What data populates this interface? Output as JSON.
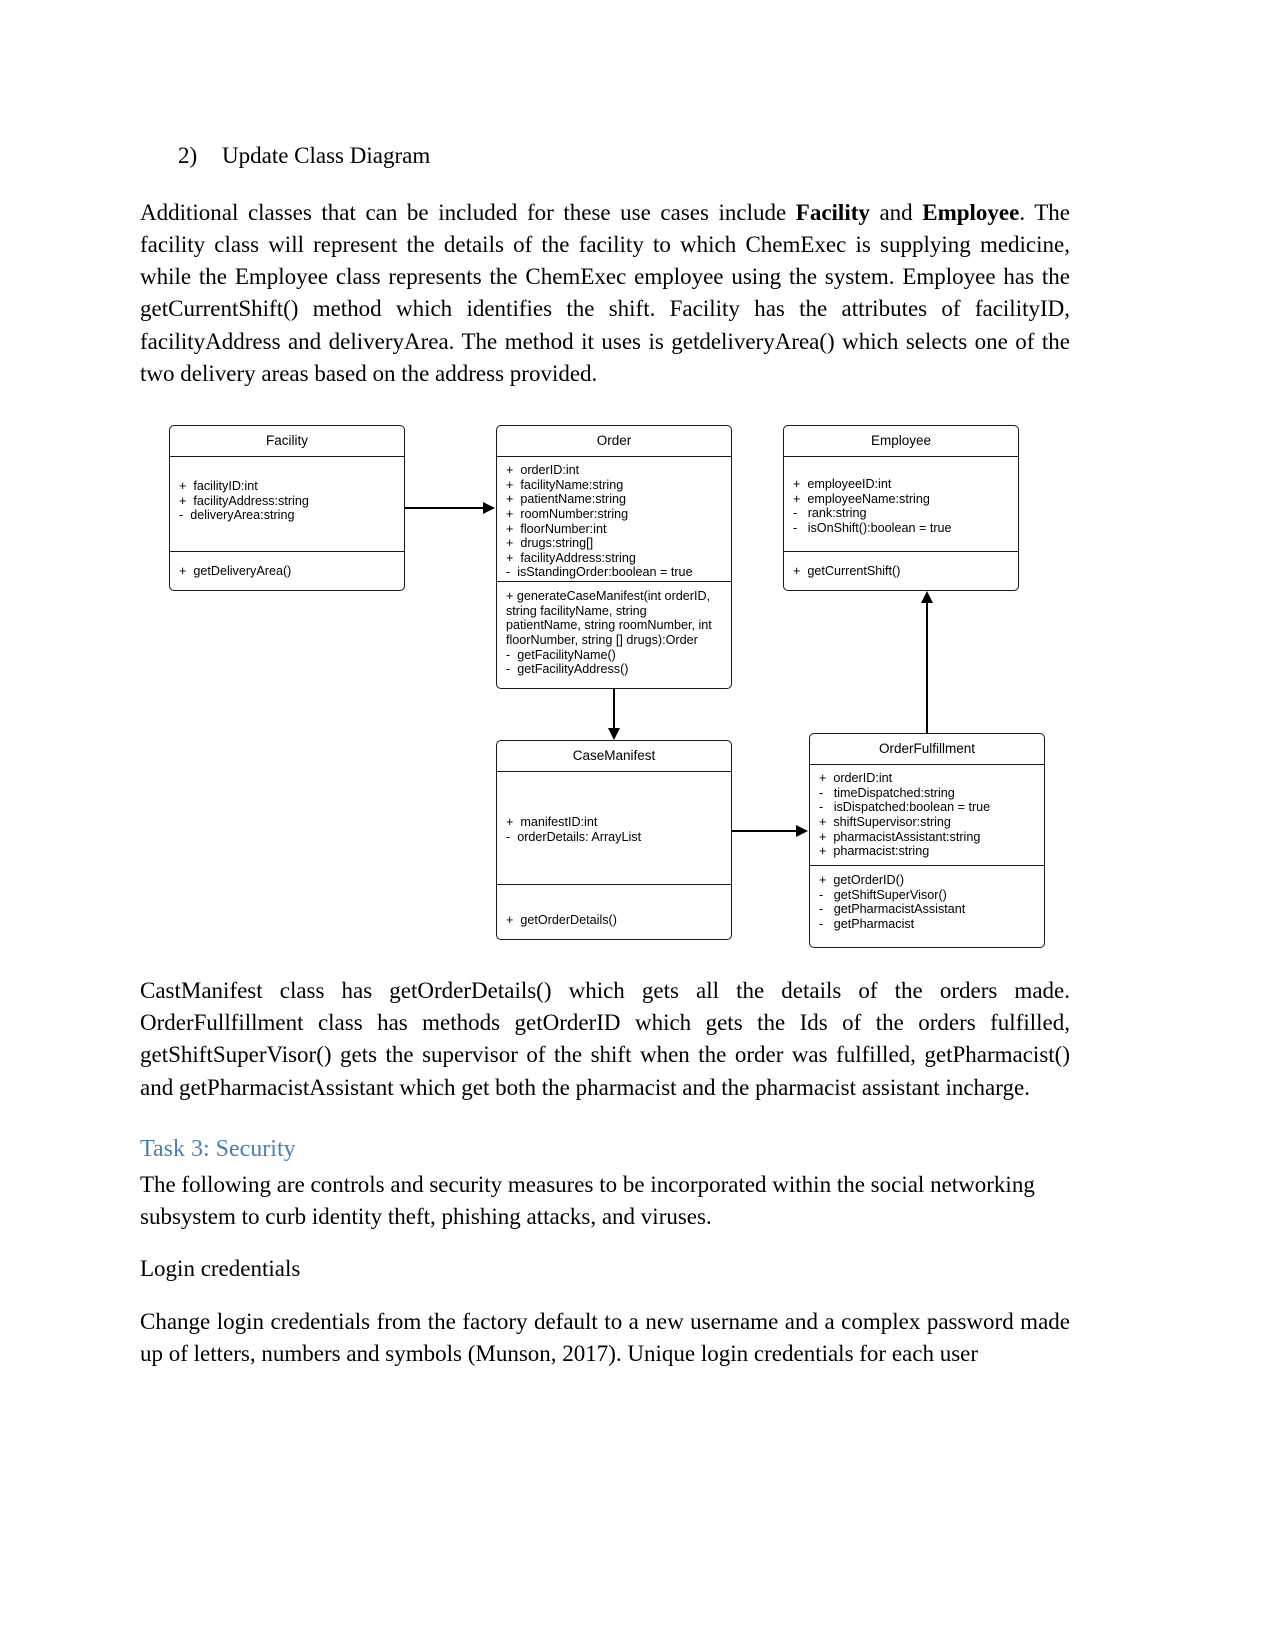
{
  "section": {
    "number": "2)",
    "title": "Update Class Diagram"
  },
  "paragraphs": {
    "intro_a": "Additional classes that can be included for these use cases include ",
    "intro_bold1": "Facility",
    "intro_b": " and ",
    "intro_bold2": "Employee",
    "intro_c": ". The facility class will represent the details of the facility to which ChemExec is supplying medicine, while the Employee class represents the ChemExec employee using the system. Employee has the getCurrentShift() method which identifies the shift. Facility has the attributes of facilityID, facilityAddress and deliveryArea. The method it uses is getdeliveryArea() which selects one of the two delivery areas based on the address provided.",
    "after_diagram": "CastManifest class has getOrderDetails() which gets all the details of the orders made. OrderFullfillment class has methods getOrderID which gets the Ids of the orders fulfilled, getShiftSuperVisor() gets the supervisor of the shift when the order was fulfilled, getPharmacist() and getPharmacistAssistant which get both the pharmacist and the pharmacist assistant incharge.",
    "security_intro": "The following are controls and security measures to be incorporated within the social networking subsystem to curb identity theft, phishing attacks, and viruses.",
    "login_credentials_heading": "Login credentials",
    "login_body": "Change login credentials from the factory default to a new username and a complex password made up of letters, numbers and symbols (Munson, 2017). Unique login credentials for each user"
  },
  "headings": {
    "task3": "Task 3: Security",
    "task3_color": "#4a7ebb"
  },
  "diagram": {
    "classes": [
      {
        "id": "facility",
        "name": "Facility",
        "attributes": [
          "+  facilityID:int",
          "+  facilityAddress:string",
          "-  deliveryArea:string"
        ],
        "methods": [
          "+  getDeliveryArea()"
        ]
      },
      {
        "id": "order",
        "name": "Order",
        "attributes": [
          "+  orderID:int",
          "+  facilityName:string",
          "+  patientName:string",
          "+  roomNumber:string",
          "+  floorNumber:int",
          "+  drugs:string[]",
          "+  facilityAddress:string",
          "-  isStandingOrder:boolean = true"
        ],
        "methods": [
          "+  generateCaseManifest(int orderID, string facilityName, string patientName, string roomNumber, int floorNumber, string [] drugs):Order",
          "-  getFacilityName()",
          "-  getFacilityAddress()"
        ]
      },
      {
        "id": "employee",
        "name": "Employee",
        "attributes": [
          "+  employeeID:int",
          "+  employeeName:string",
          "-   rank:string",
          "-   isOnShift():boolean = true"
        ],
        "methods": [
          "+  getCurrentShift()"
        ]
      },
      {
        "id": "casemanifest",
        "name": "CaseManifest",
        "attributes": [
          "+  manifestID:int",
          "-  orderDetails: ArrayList"
        ],
        "methods": [
          "+  getOrderDetails()"
        ]
      },
      {
        "id": "orderfulfillment",
        "name": "OrderFulfillment",
        "attributes": [
          "+  orderID:int",
          "-   timeDispatched:string",
          "-   isDispatched:boolean = true",
          "+  shiftSupervisor:string",
          "+  pharmacistAssistant:string",
          "+  pharmacist:string"
        ],
        "methods": [
          "+  getOrderID()",
          "-   getShiftSuperVisor()",
          "-   getPharmacistAssistant",
          "-   getPharmacist"
        ]
      }
    ],
    "connectors": [
      {
        "from": "facility",
        "to": "order",
        "direction": "right"
      },
      {
        "from": "order",
        "to": "casemanifest",
        "direction": "down"
      },
      {
        "from": "casemanifest",
        "to": "orderfulfillment",
        "direction": "right"
      },
      {
        "from": "orderfulfillment",
        "to": "employee",
        "direction": "up"
      }
    ]
  }
}
